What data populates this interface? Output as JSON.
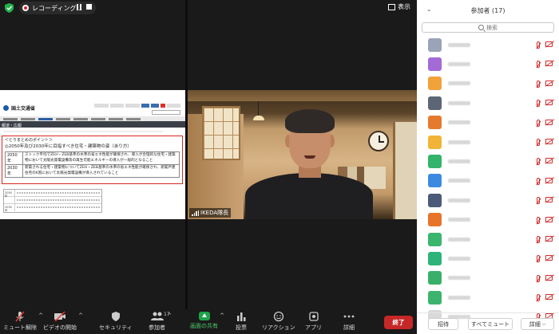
{
  "topbar": {
    "recording_label": "レコーディング...",
    "view_label": "表示"
  },
  "shared_screen": {
    "site_logo_text": "国土交通省",
    "breadcrumb": "報道・広報",
    "summary_heading": "＜とりまとめのポイント＞",
    "summary_subheading": "◎2050年及び2030年に目指すべき住宅・建築物の姿（あり方）",
    "rows": [
      {
        "year": "2050年",
        "text": "ストック平均でZEH・ZEB基準の水準の省エネ性能が確保され、導入が合理的な住宅・建築物において太陽光発電設備等の再生可能エネルギーの導入が一般的となること"
      },
      {
        "year": "2030年",
        "text": "新築される住宅・建築物についてZEH・ZEB基準の水準の省エネ性能が確保され、新築戸建住宅の6割において太陽光発電設備が導入されていること"
      }
    ],
    "lower_rows": [
      "2050年",
      "2030年"
    ]
  },
  "video": {
    "participant_name": "IKEDA隊長"
  },
  "toolbar": {
    "mute": "ミュート解除",
    "video": "ビデオの開始",
    "security": "セキュリティ",
    "participants": "参加者",
    "participants_count": "17",
    "share": "画面の共有",
    "polls": "投票",
    "reactions": "リアクション",
    "apps": "アプリ",
    "more": "詳細",
    "end": "終了"
  },
  "panel": {
    "title": "参加者 (17)",
    "search_placeholder": "検索",
    "invite": "招待",
    "mute_all": "すべてミュート",
    "more": "詳細",
    "avatar_colors": [
      "#9aa3b8",
      "#a46bd6",
      "#f2a23a",
      "#5d6675",
      "#e57a2e",
      "#f2b436",
      "#34b36a",
      "#3c8ae0",
      "#4a5a78",
      "#e8742c",
      "#3ab56e",
      "#2eb37a",
      "#38b06a",
      "#3db46d",
      "#d9d9d9"
    ]
  }
}
